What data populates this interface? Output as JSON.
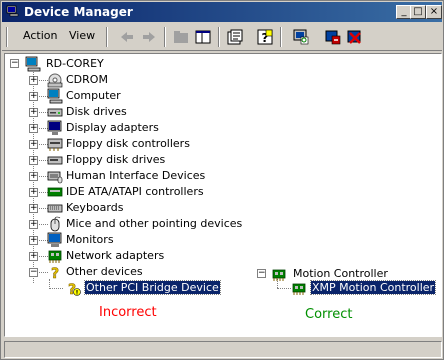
{
  "window": {
    "title": "Device Manager"
  },
  "title_buttons": {
    "minimize": "_",
    "maximize": "□",
    "close": "×"
  },
  "menu": [
    {
      "label": "Action"
    },
    {
      "label": "View"
    }
  ],
  "toolbar_icons": [
    "back-icon",
    "forward-icon",
    "up-folder-icon",
    "show-hide-tree-icon",
    "properties-icon",
    "help-icon",
    "scan-hardware-icon",
    "update-driver-icon",
    "uninstall-icon"
  ],
  "tree": {
    "root": "RD-COREY",
    "categories": [
      {
        "label": "CDROM",
        "icon": "cdrom-icon"
      },
      {
        "label": "Computer",
        "icon": "computer-icon"
      },
      {
        "label": "Disk drives",
        "icon": "disk-drive-icon"
      },
      {
        "label": "Display adapters",
        "icon": "display-adapter-icon"
      },
      {
        "label": "Floppy disk controllers",
        "icon": "floppy-controller-icon"
      },
      {
        "label": "Floppy disk drives",
        "icon": "floppy-drive-icon"
      },
      {
        "label": "Human Interface Devices",
        "icon": "hid-icon"
      },
      {
        "label": "IDE ATA/ATAPI controllers",
        "icon": "ide-controller-icon"
      },
      {
        "label": "Keyboards",
        "icon": "keyboard-icon"
      },
      {
        "label": "Mice and other pointing devices",
        "icon": "mouse-icon"
      },
      {
        "label": "Monitors",
        "icon": "monitor-icon"
      },
      {
        "label": "Network adapters",
        "icon": "network-adapter-icon"
      },
      {
        "label": "Other devices",
        "icon": "unknown-device-icon",
        "expanded": true
      }
    ],
    "other_child": "Other PCI Bridge Device"
  },
  "motion": {
    "parent": "Motion Controller",
    "child": "XMP Motion Controller"
  },
  "annotations": {
    "incorrect": "Incorrect",
    "correct": "Correct",
    "incorrect_color": "#ff0000",
    "correct_color": "#009000"
  },
  "colors": {
    "title_start": "#0a246a",
    "title_end": "#3a6ea5",
    "selection": "#0a246a"
  }
}
